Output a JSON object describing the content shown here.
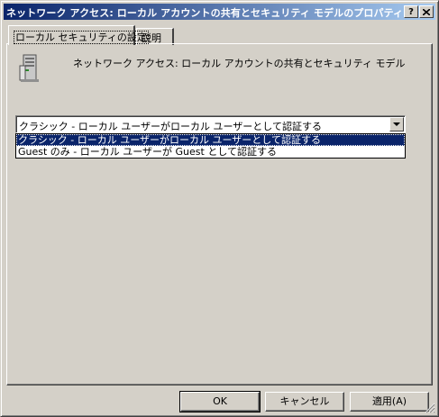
{
  "window": {
    "title": "ネットワーク アクセス: ローカル アカウントの共有とセキュリティ モデルのプロパティ",
    "help_label": "?",
    "close_label": "X"
  },
  "tabs": [
    {
      "label": "ローカル セキュリティの設定",
      "selected": true
    },
    {
      "label": "説明",
      "selected": false
    }
  ],
  "policy": {
    "icon": "server-computer-icon",
    "title": "ネットワーク アクセス: ローカル アカウントの共有とセキュリティ モデル"
  },
  "combo": {
    "selected": "クラシック - ローカル ユーザーがローカル ユーザーとして認証する",
    "options": [
      "クラシック - ローカル ユーザーがローカル ユーザーとして認証する",
      "Guest のみ - ローカル ユーザーが Guest として認証する"
    ]
  },
  "buttons": {
    "ok": "OK",
    "cancel": "キャンセル",
    "apply": "適用(A)"
  },
  "colors": {
    "face": "#d4d0c8",
    "title_start": "#0a246a",
    "title_end": "#a6caf0",
    "highlight": "#0a246a"
  }
}
